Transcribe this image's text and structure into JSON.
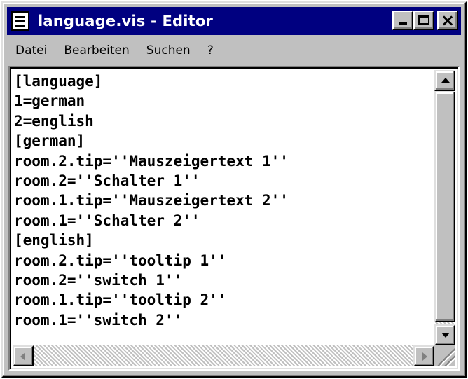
{
  "window": {
    "title": "language.vis - Editor"
  },
  "menu": [
    {
      "accel": "D",
      "rest": "atei"
    },
    {
      "accel": "B",
      "rest": "earbeiten"
    },
    {
      "accel": "S",
      "rest": "uchen"
    },
    {
      "accel": "?",
      "rest": ""
    }
  ],
  "editor": {
    "lines": [
      "[language]",
      "1=german",
      "2=english",
      "[german]",
      "room.2.tip=''Mauszeigertext 1''",
      "room.2=''Schalter 1''",
      "room.1.tip=''Mauszeigertext 2''",
      "room.1=''Schalter 2''",
      "[english]",
      "room.2.tip=''tooltip 1''",
      "room.2=''switch 1''",
      "room.1.tip=''tooltip 2''",
      "room.1=''switch 2''"
    ]
  },
  "icons": {
    "app": "notepad-icon",
    "minimize": "minimize-icon",
    "maximize": "maximize-icon",
    "close": "close-icon"
  },
  "colors": {
    "titlebar": "#000080",
    "face": "#c0c0c0",
    "text_background": "#ffffff"
  }
}
